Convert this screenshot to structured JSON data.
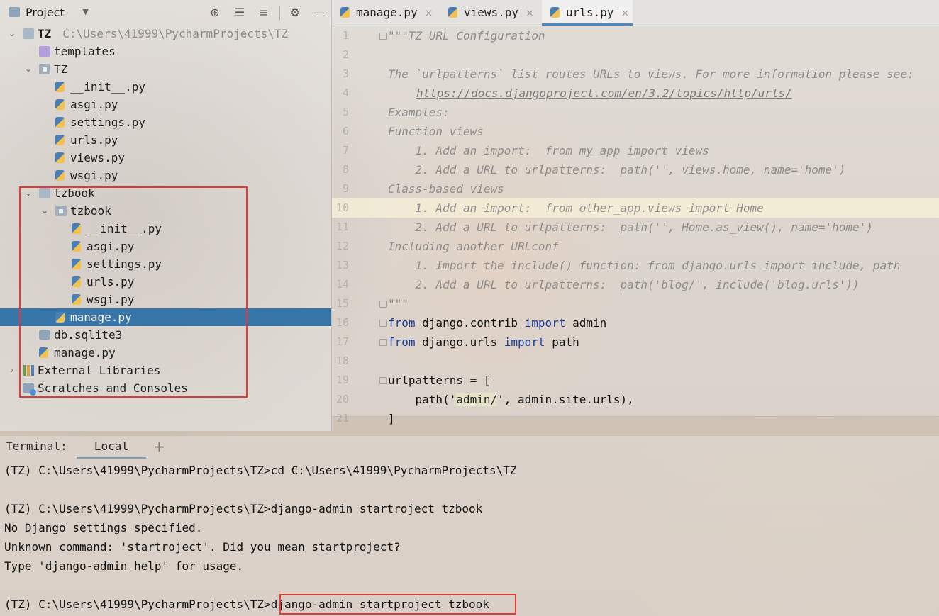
{
  "project_panel": {
    "title": "Project",
    "tree": [
      {
        "name": "TZ",
        "hint": "C:\\Users\\41999\\PycharmProjects\\TZ",
        "type": "root-folder",
        "expanded": true
      },
      {
        "name": "templates",
        "type": "folder-purple"
      },
      {
        "name": "TZ",
        "type": "package",
        "expanded": true
      },
      {
        "name": "__init__.py",
        "type": "py"
      },
      {
        "name": "asgi.py",
        "type": "py"
      },
      {
        "name": "settings.py",
        "type": "py"
      },
      {
        "name": "urls.py",
        "type": "py"
      },
      {
        "name": "views.py",
        "type": "py"
      },
      {
        "name": "wsgi.py",
        "type": "py"
      },
      {
        "name": "tzbook",
        "type": "folder",
        "expanded": true
      },
      {
        "name": "tzbook",
        "type": "package",
        "expanded": true
      },
      {
        "name": "__init__.py",
        "type": "py"
      },
      {
        "name": "asgi.py",
        "type": "py"
      },
      {
        "name": "settings.py",
        "type": "py"
      },
      {
        "name": "urls.py",
        "type": "py"
      },
      {
        "name": "wsgi.py",
        "type": "py"
      },
      {
        "name": "manage.py",
        "type": "py",
        "selected": true
      },
      {
        "name": "db.sqlite3",
        "type": "db"
      },
      {
        "name": "manage.py",
        "type": "py"
      },
      {
        "name": "External Libraries",
        "type": "libs"
      },
      {
        "name": "Scratches and Consoles",
        "type": "scratches"
      }
    ]
  },
  "editor": {
    "tabs": [
      {
        "label": "manage.py"
      },
      {
        "label": "views.py"
      },
      {
        "label": "urls.py",
        "active": true
      }
    ],
    "lines": [
      {
        "n": "1",
        "text": "\"\"\"TZ URL Configuration"
      },
      {
        "n": "2",
        "text": ""
      },
      {
        "n": "3",
        "text": "The `urlpatterns` list routes URLs to views. For more information please see:"
      },
      {
        "n": "4",
        "text": "https://docs.djangoproject.com/en/3.2/topics/http/urls/"
      },
      {
        "n": "5",
        "text": "Examples:"
      },
      {
        "n": "6",
        "text": "Function views"
      },
      {
        "n": "7",
        "text": "    1. Add an import:  from my_app import views"
      },
      {
        "n": "8",
        "text": "    2. Add a URL to urlpatterns:  path('', views.home, name='home')"
      },
      {
        "n": "9",
        "text": "Class-based views"
      },
      {
        "n": "10",
        "text": "    1. Add an import:  from other_app.views import Home"
      },
      {
        "n": "11",
        "text": "    2. Add a URL to urlpatterns:  path('', Home.as_view(), name='home')"
      },
      {
        "n": "12",
        "text": "Including another URLconf"
      },
      {
        "n": "13",
        "text": "    1. Import the include() function: from django.urls import include, path"
      },
      {
        "n": "14",
        "text": "    2. Add a URL to urlpatterns:  path('blog/', include('blog.urls'))"
      },
      {
        "n": "15",
        "text": "\"\"\""
      },
      {
        "n": "16",
        "kw1": "from",
        "mid": " django.contrib ",
        "kw2": "import",
        "end": " admin"
      },
      {
        "n": "17",
        "kw1": "from",
        "mid": " django.urls ",
        "kw2": "import",
        "end": " path"
      },
      {
        "n": "18",
        "text": ""
      },
      {
        "n": "19",
        "text": "urlpatterns = ["
      },
      {
        "n": "20",
        "pre": "    path('",
        "str": "admin/",
        "post": "', admin.site.urls),"
      },
      {
        "n": "21",
        "text": "]"
      }
    ],
    "current_line": "10"
  },
  "terminal": {
    "title": "Terminal:",
    "tab": "Local",
    "add_symbol": "+",
    "lines": [
      "(TZ) C:\\Users\\41999\\PycharmProjects\\TZ>cd C:\\Users\\41999\\PycharmProjects\\TZ",
      "",
      "(TZ) C:\\Users\\41999\\PycharmProjects\\TZ>django-admin startroject tzbook",
      "No Django settings specified.",
      "Unknown command: 'startroject'. Did you mean startproject?",
      "Type 'django-admin help' for usage.",
      ""
    ],
    "last_prompt": "(TZ) C:\\Users\\41999\\PycharmProjects\\TZ>",
    "last_command": "django-admin startproject tzbook"
  },
  "colors": {
    "selection": "#3875a8",
    "highlight_box": "#e53935",
    "keyword": "#1a3f9e",
    "current_line": "#fcf6da"
  }
}
